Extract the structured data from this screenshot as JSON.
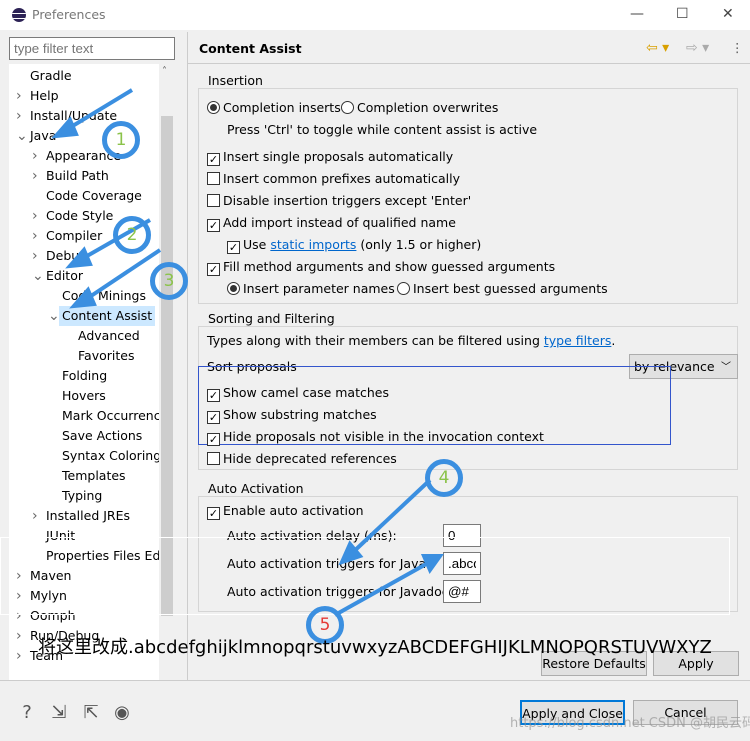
{
  "window": {
    "title": "Preferences",
    "minimize": "—",
    "maximize": "☐",
    "close": "✕"
  },
  "filter": {
    "placeholder": "type filter text"
  },
  "tree": [
    {
      "label": "Gradle",
      "level": 0,
      "chevron": ""
    },
    {
      "label": "Help",
      "level": 0,
      "chevron": ">"
    },
    {
      "label": "Install/Update",
      "level": 0,
      "chevron": ">"
    },
    {
      "label": "Java",
      "level": 0,
      "chevron": "v"
    },
    {
      "label": "Appearance",
      "level": 1,
      "chevron": ">"
    },
    {
      "label": "Build Path",
      "level": 1,
      "chevron": ">"
    },
    {
      "label": "Code Coverage",
      "level": 1,
      "chevron": ""
    },
    {
      "label": "Code Style",
      "level": 1,
      "chevron": ">"
    },
    {
      "label": "Compiler",
      "level": 1,
      "chevron": ">"
    },
    {
      "label": "Debug",
      "level": 1,
      "chevron": ">"
    },
    {
      "label": "Editor",
      "level": 1,
      "chevron": "v"
    },
    {
      "label": "Code Minings",
      "level": 2,
      "chevron": ""
    },
    {
      "label": "Content Assist",
      "level": 2,
      "chevron": "v",
      "selected": true
    },
    {
      "label": "Advanced",
      "level": 3,
      "chevron": ""
    },
    {
      "label": "Favorites",
      "level": 3,
      "chevron": ""
    },
    {
      "label": "Folding",
      "level": 2,
      "chevron": ""
    },
    {
      "label": "Hovers",
      "level": 2,
      "chevron": ""
    },
    {
      "label": "Mark Occurrences",
      "level": 2,
      "chevron": ""
    },
    {
      "label": "Save Actions",
      "level": 2,
      "chevron": ""
    },
    {
      "label": "Syntax Coloring",
      "level": 2,
      "chevron": ""
    },
    {
      "label": "Templates",
      "level": 2,
      "chevron": ""
    },
    {
      "label": "Typing",
      "level": 2,
      "chevron": ""
    },
    {
      "label": "Installed JREs",
      "level": 1,
      "chevron": ">"
    },
    {
      "label": "JUnit",
      "level": 1,
      "chevron": ""
    },
    {
      "label": "Properties Files Editor",
      "level": 1,
      "chevron": ""
    },
    {
      "label": "Maven",
      "level": 0,
      "chevron": ">"
    },
    {
      "label": "Mylyn",
      "level": 0,
      "chevron": ">"
    },
    {
      "label": "Oomph",
      "level": 0,
      "chevron": ">"
    },
    {
      "label": "Run/Debug",
      "level": 0,
      "chevron": ">"
    },
    {
      "label": "Team",
      "level": 0,
      "chevron": ">"
    }
  ],
  "page": {
    "title": "Content Assist"
  },
  "insertion": {
    "label": "Insertion",
    "radio_inserts": "Completion inserts",
    "radio_overwrites": "Completion overwrites",
    "hint": "Press 'Ctrl' to toggle while content assist is active",
    "insert_single": "Insert single proposals automatically",
    "insert_common": "Insert common prefixes automatically",
    "disable_triggers": "Disable insertion triggers except 'Enter'",
    "add_import": "Add import instead of qualified name",
    "use": "Use",
    "static_imports": "static imports",
    "only": "(only 1.5 or higher)",
    "fill_args": "Fill method arguments and show guessed arguments",
    "insert_param": "Insert parameter names",
    "insert_best": "Insert best guessed arguments"
  },
  "sorting": {
    "label": "Sorting and Filtering",
    "types_text": "Types along with their members can be filtered using",
    "type_filters": "type filters",
    "period": ".",
    "sort_proposals": "Sort proposals",
    "sort_value": "by relevance",
    "camel": "Show camel case matches",
    "substring": "Show substring matches",
    "hide_invisible": "Hide proposals not visible in the invocation context",
    "hide_deprecated": "Hide deprecated references"
  },
  "auto": {
    "label": "Auto Activation",
    "enable": "Enable auto activation",
    "delay_label": "Auto activation delay (ms):",
    "delay_value": "0",
    "java_label": "Auto activation triggers for Java:",
    "java_value": ".abcd",
    "javadoc_label": "Auto activation triggers for Javadoc:",
    "javadoc_value": "@#"
  },
  "buttons": {
    "restore": "Restore Defaults",
    "apply": "Apply",
    "apply_close": "Apply and Close",
    "cancel": "Cancel"
  },
  "annotations": {
    "n1": "1",
    "n2": "2",
    "n3": "3",
    "n4": "4",
    "n5": "5",
    "note": "将这里改成.abcdefghijklmnopqrstuvwxyzABCDEFGHIJKLMNOPQRSTUVWXYZ",
    "watermark": "https://blog.csdn.net CSDN @胡民云码",
    "arrow_color": "#3b8fe0"
  }
}
